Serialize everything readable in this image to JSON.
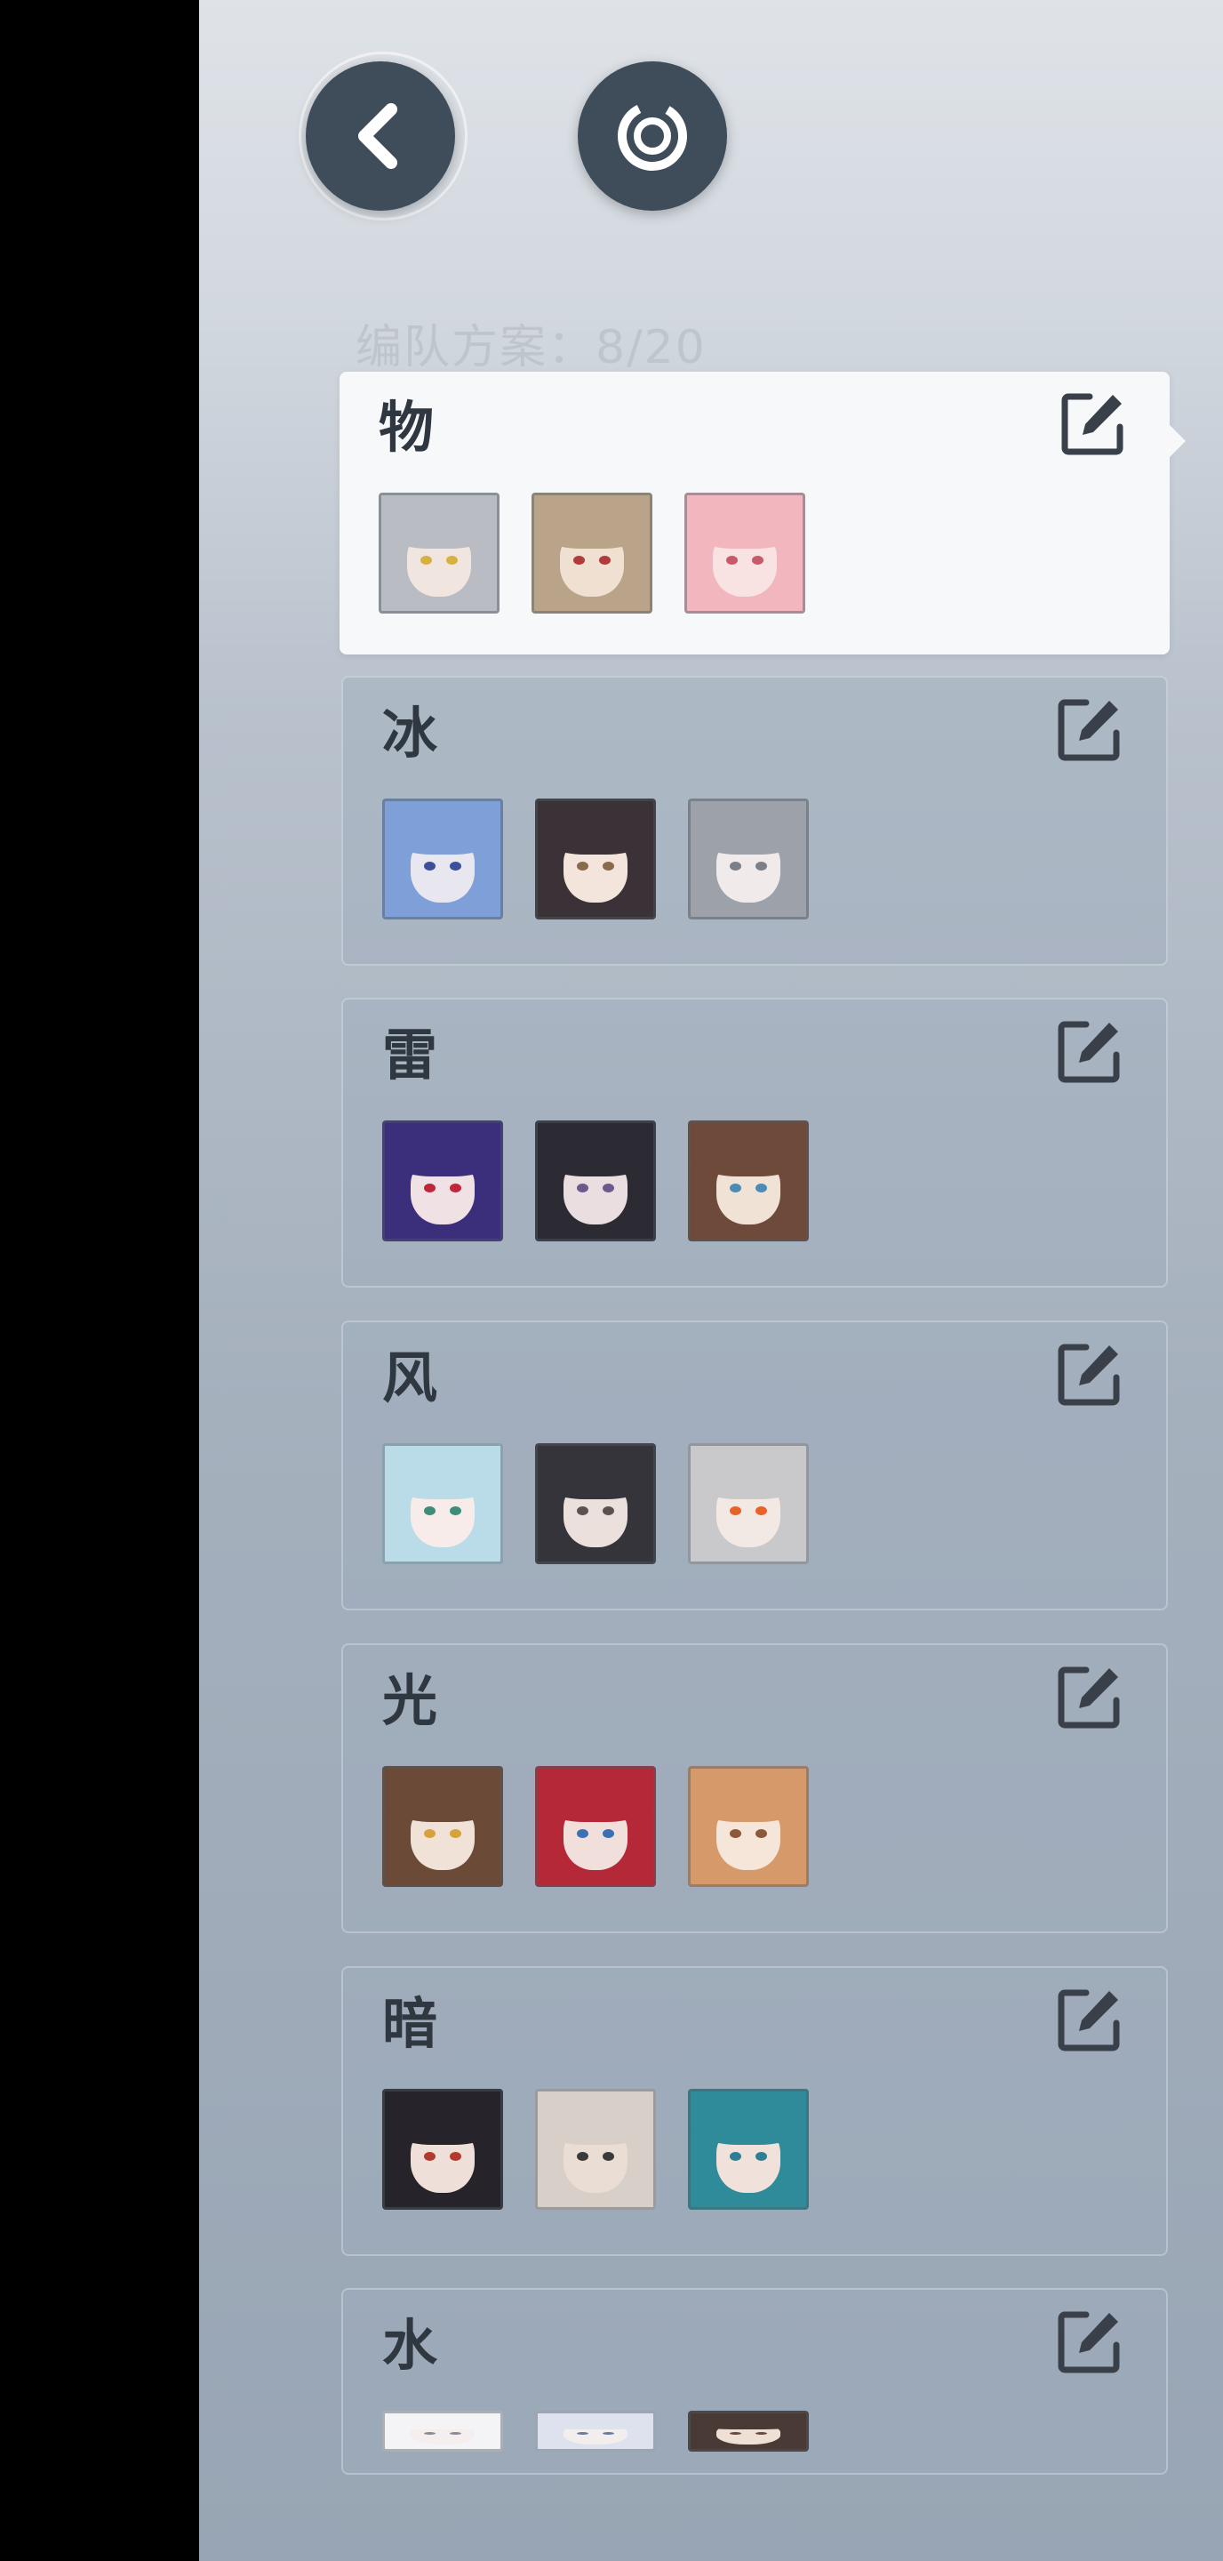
{
  "header": {
    "plan_count_label": "编队方案：",
    "plan_count_value": "8/20"
  },
  "teams": [
    {
      "name": "物",
      "selected": true,
      "members": [
        {
          "hair": "#b9bcc2",
          "skin": "#f1e6df",
          "eye": "#d8b040"
        },
        {
          "hair": "#b9a489",
          "skin": "#efe0d2",
          "eye": "#b23a3a"
        },
        {
          "hair": "#f2b6bf",
          "skin": "#f8e2e2",
          "eye": "#c9586a"
        }
      ]
    },
    {
      "name": "冰",
      "selected": false,
      "members": [
        {
          "hair": "#7f9fd8",
          "skin": "#e8e6ee",
          "eye": "#3b4f9a"
        },
        {
          "hair": "#3a3236",
          "skin": "#f3e5dc",
          "eye": "#8a6a4c"
        },
        {
          "hair": "#9da1aa",
          "skin": "#f0eaea",
          "eye": "#7b7f88"
        }
      ]
    },
    {
      "name": "雷",
      "selected": false,
      "members": [
        {
          "hair": "#3b2e7a",
          "skin": "#efe1e4",
          "eye": "#c0263a"
        },
        {
          "hair": "#2c2a33",
          "skin": "#eadee0",
          "eye": "#6b5a8c"
        },
        {
          "hair": "#6e4a3a",
          "skin": "#f1e2d6",
          "eye": "#4c8bb5"
        }
      ]
    },
    {
      "name": "风",
      "selected": false,
      "members": [
        {
          "hair": "#b9dce8",
          "skin": "#f7ecea",
          "eye": "#3e8c7a"
        },
        {
          "hair": "#35343b",
          "skin": "#ece0dc",
          "eye": "#59524f"
        },
        {
          "hair": "#c9c9cc",
          "skin": "#f2e8e4",
          "eye": "#e8632a"
        }
      ]
    },
    {
      "name": "光",
      "selected": false,
      "members": [
        {
          "hair": "#6b4a38",
          "skin": "#f1e2d8",
          "eye": "#d7a23a"
        },
        {
          "hair": "#b42838",
          "skin": "#f1dfdb",
          "eye": "#3c6fb4"
        },
        {
          "hair": "#d69a6a",
          "skin": "#f6e6da",
          "eye": "#8c5a3a"
        }
      ]
    },
    {
      "name": "暗",
      "selected": false,
      "members": [
        {
          "hair": "#26242a",
          "skin": "#eedfd8",
          "eye": "#b43a2e"
        },
        {
          "hair": "#d8d0c8",
          "skin": "#e9ddd4",
          "eye": "#3a3a3a"
        },
        {
          "hair": "#2f8a99",
          "skin": "#f0e2da",
          "eye": "#2e7f93"
        }
      ]
    },
    {
      "name": "水",
      "selected": false,
      "members": [
        {
          "hair": "#f4f4f6",
          "skin": "#f4eeee",
          "eye": "#8a8a98"
        },
        {
          "hair": "#dde2ee",
          "skin": "#f2eeee",
          "eye": "#6a7aa8"
        },
        {
          "hair": "#4a3a36",
          "skin": "#efe0d6",
          "eye": "#6a4a3a"
        }
      ]
    }
  ]
}
